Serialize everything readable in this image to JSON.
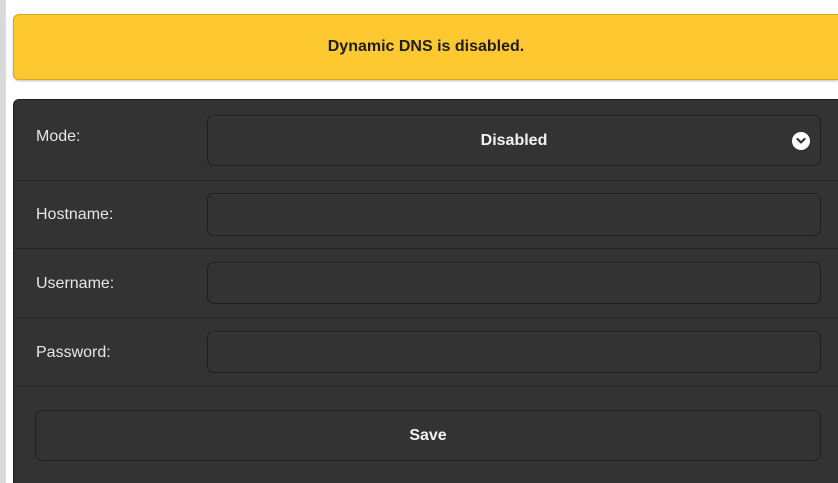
{
  "banner": {
    "message": "Dynamic DNS is disabled."
  },
  "form": {
    "mode": {
      "label": "Mode:",
      "selected": "Disabled",
      "icon": "chevron-down-icon"
    },
    "hostname": {
      "label": "Hostname:",
      "value": ""
    },
    "username": {
      "label": "Username:",
      "value": ""
    },
    "password": {
      "label": "Password:",
      "value": ""
    },
    "save_label": "Save"
  },
  "colors": {
    "banner_bg": "#fdc830",
    "panel_bg": "#333333",
    "text_light": "#e6e6e6"
  }
}
